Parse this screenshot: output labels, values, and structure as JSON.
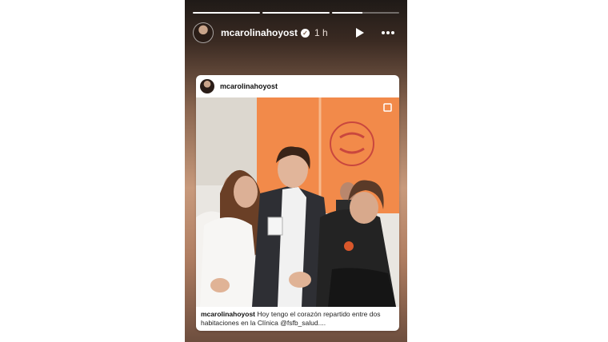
{
  "story": {
    "progress": [
      1.0,
      1.0,
      0.45
    ],
    "username": "mcarolinahoyost",
    "time": "1 h"
  },
  "post": {
    "username": "mcarolinahoyost",
    "caption_user": "mcarolinahoyost",
    "caption_text": "Hoy tengo el corazón repartido entre dos habitaciones en la Clínica @fsfb_salud...."
  },
  "colors": {
    "banner": "#f28a4a",
    "wall": "#e9e6e1",
    "background": "#ffffff"
  },
  "icons": [
    "play-icon",
    "more-icon",
    "verified-icon",
    "expand-icon"
  ]
}
